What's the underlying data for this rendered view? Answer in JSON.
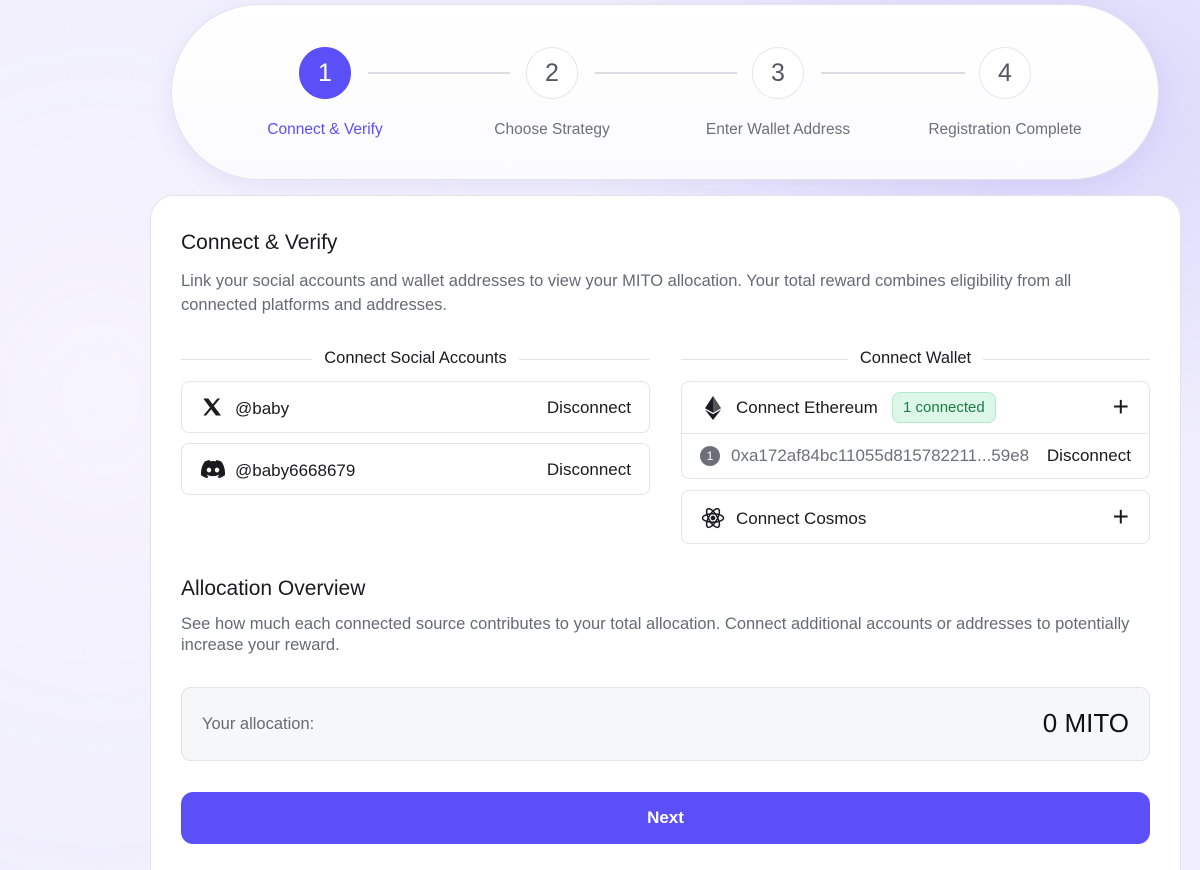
{
  "stepper": {
    "steps": [
      {
        "number": "1",
        "label": "Connect & Verify",
        "state": "active"
      },
      {
        "number": "2",
        "label": "Choose Strategy",
        "state": "pending"
      },
      {
        "number": "3",
        "label": "Enter Wallet Address",
        "state": "pending"
      },
      {
        "number": "4",
        "label": "Registration Complete",
        "state": "pending"
      }
    ]
  },
  "connect": {
    "title": "Connect & Verify",
    "description": "Link your social accounts and wallet addresses to view your MITO allocation. Your total reward combines eligibility from all connected platforms and addresses."
  },
  "social": {
    "heading": "Connect Social Accounts",
    "accounts": [
      {
        "icon": "x-logo-icon",
        "handle": "@baby",
        "action": "Disconnect"
      },
      {
        "icon": "discord-logo-icon",
        "handle": "@baby6668679",
        "action": "Disconnect"
      }
    ]
  },
  "wallet": {
    "heading": "Connect Wallet",
    "ethereum": {
      "icon": "ethereum-icon",
      "label": "Connect Ethereum",
      "badge": "1 connected",
      "add": "+",
      "addresses": [
        {
          "index": "1",
          "address": "0xa172af84bc11055d815782211...59e8",
          "action": "Disconnect"
        }
      ]
    },
    "cosmos": {
      "icon": "cosmos-icon",
      "label": "Connect Cosmos",
      "add": "+"
    }
  },
  "allocation": {
    "title": "Allocation Overview",
    "description": "See how much each connected source contributes to your total allocation. Connect additional accounts or addresses to potentially increase your reward.",
    "label": "Your allocation:",
    "value": "0 MITO"
  },
  "next_label": "Next",
  "colors": {
    "accent": "#5b4ff8",
    "badge_bg": "#dcf7e7",
    "badge_text": "#1d7a47"
  }
}
